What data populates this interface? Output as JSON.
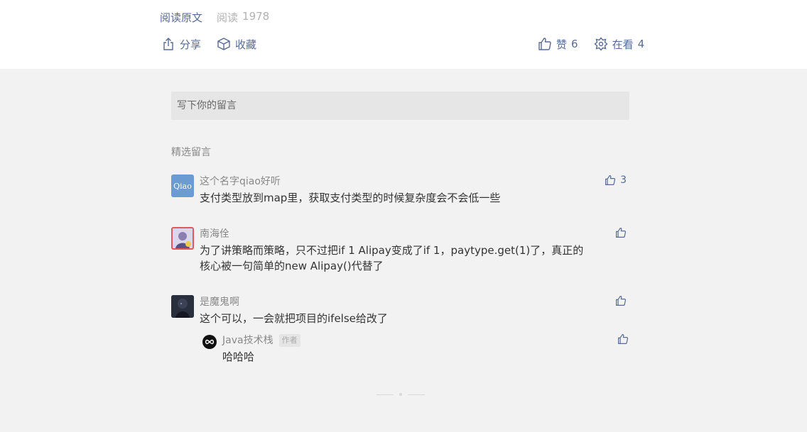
{
  "header": {
    "read_original": "阅读原文",
    "read_label": "阅读",
    "read_count": "1978",
    "share_label": "分享",
    "favorite_label": "收藏",
    "like_label": "赞",
    "like_count": "6",
    "watching_label": "在看",
    "watching_count": "4"
  },
  "composer": {
    "placeholder": "写下你的留言"
  },
  "comments_section": {
    "title": "精选留言",
    "comments": [
      {
        "nickname": "这个名字qiao好听",
        "avatar_text": "Qiao",
        "text": "支付类型放到map里，获取支付类型的时候复杂度会不会低一些",
        "likes": "3"
      },
      {
        "nickname": "南海佺",
        "text_line1": "为了讲策略而策略，只不过把if 1 Alipay变成了if 1，paytype.get(1)了，真正的",
        "text_line2": "核心被一句简单的new Alipay()代替了",
        "likes": ""
      },
      {
        "nickname": "是魔鬼啊",
        "text": "这个可以，一会就把项目的ifelse给改了",
        "likes": "",
        "reply": {
          "nickname": "Java技术栈",
          "badge": "作者",
          "text": "哈哈哈"
        }
      }
    ]
  },
  "colors": {
    "link": "#576b95",
    "page_bg": "#f2f2f2",
    "top_bg": "#ffffff"
  }
}
